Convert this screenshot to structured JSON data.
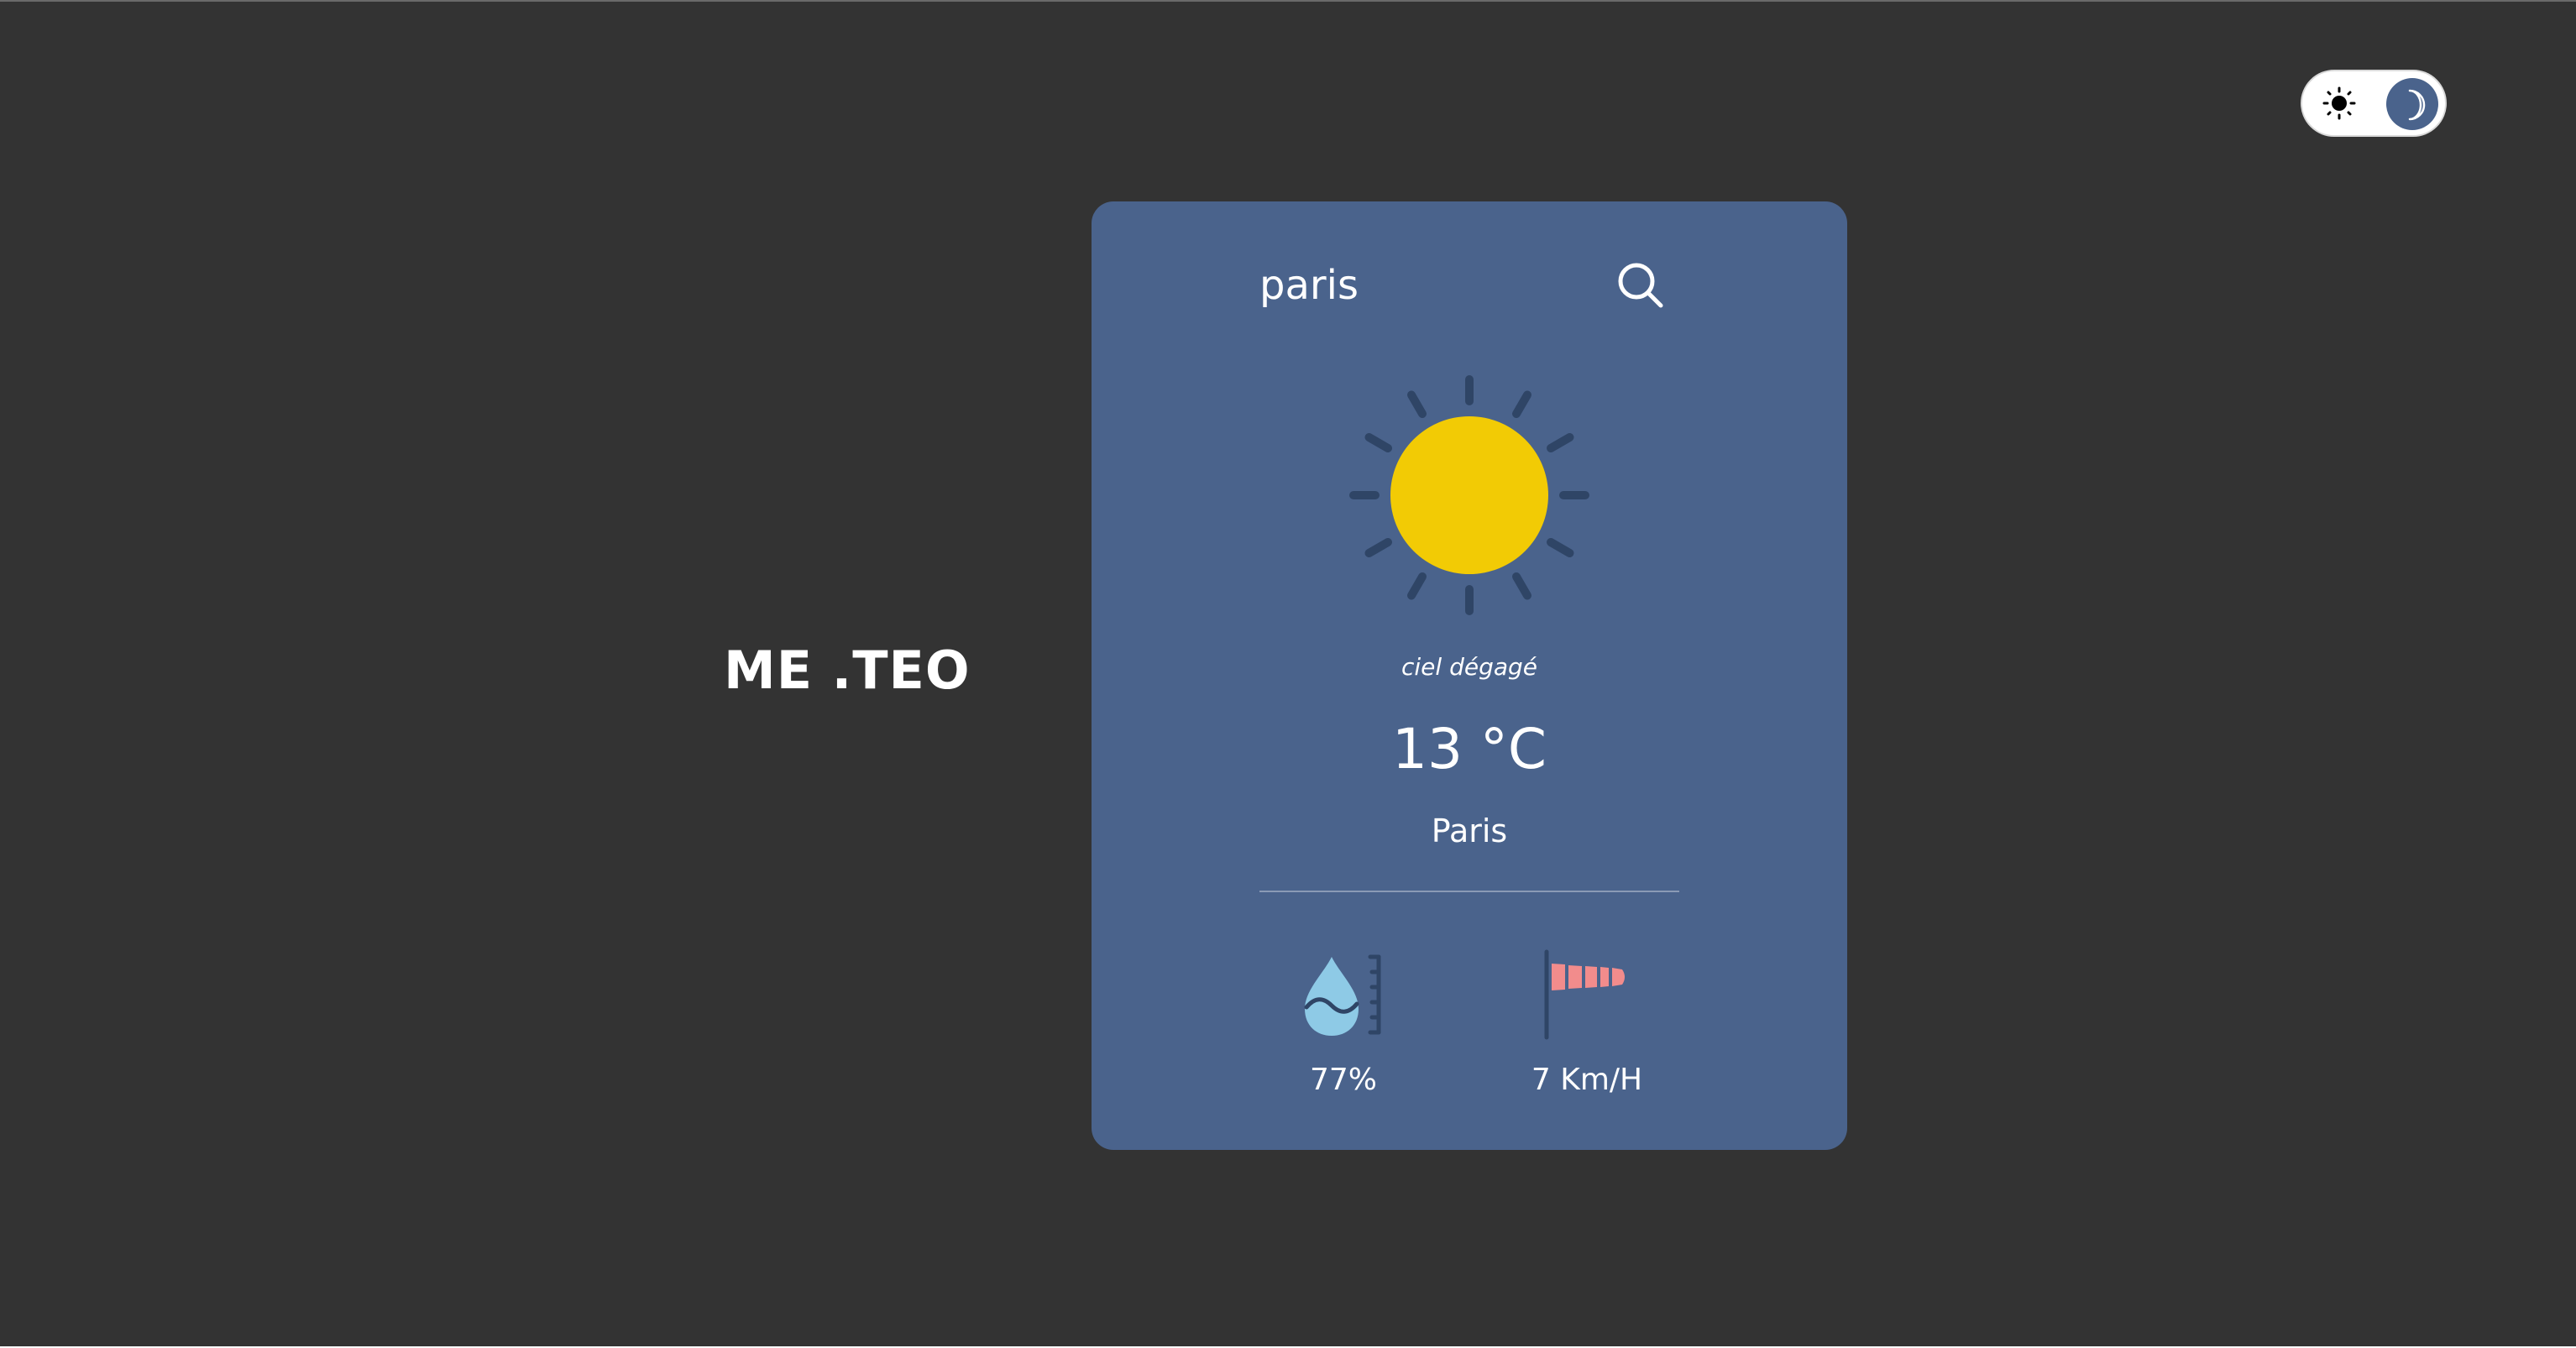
{
  "app": {
    "logo": "ME .TEO"
  },
  "theme_toggle": {
    "light_icon": "sun-icon",
    "dark_icon": "moon-icon",
    "active": "dark"
  },
  "weather": {
    "search_value": "paris",
    "search_icon": "search-icon",
    "condition_icon": "sun-icon",
    "description": "ciel dégagé",
    "temperature": "13 °C",
    "city": "Paris",
    "humidity": "77%",
    "humidity_icon": "humidity-drop-icon",
    "wind": "7 Km/H",
    "wind_icon": "windsock-icon"
  },
  "colors": {
    "background": "#333333",
    "card": "#4a638c",
    "sun": "#f2cb05",
    "sun_rays": "#2f4566",
    "drop": "#8ecae6",
    "windsock": "#f28c8c"
  }
}
